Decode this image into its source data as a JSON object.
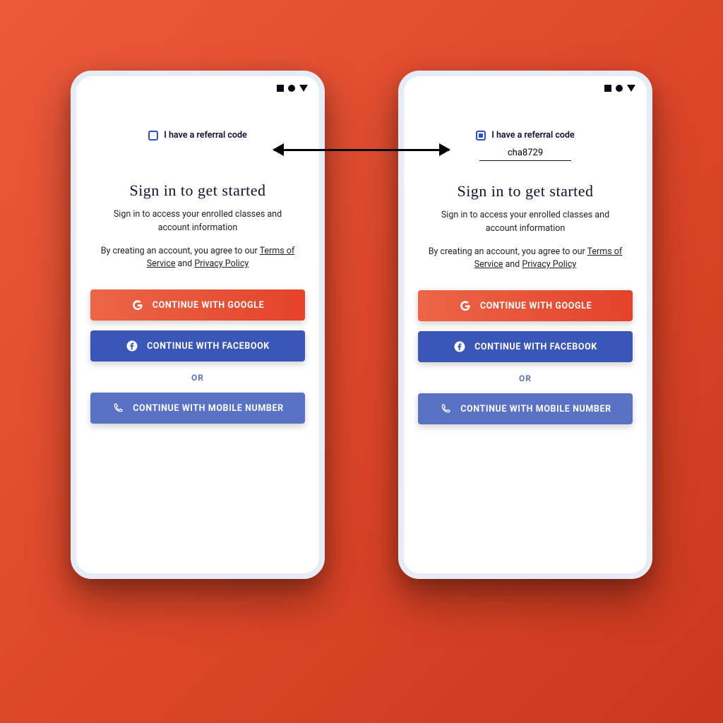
{
  "referral": {
    "label": "I have a referral code",
    "code_value": "cha8729"
  },
  "signin": {
    "title": "Sign in to get started",
    "subtitle": "Sign in to access your enrolled classes and account information",
    "terms_prefix": "By creating an account, you agree to our ",
    "terms_of_service": "Terms of Service",
    "and": " and ",
    "privacy_policy": "Privacy Policy"
  },
  "buttons": {
    "google": "CONTINUE WITH GOOGLE",
    "facebook": "CONTINUE WITH FACEBOOK",
    "or": "OR",
    "mobile": "CONTINUE WITH MOBILE NUMBER"
  },
  "icons": {
    "google": "google-icon",
    "facebook": "facebook-icon",
    "phone": "phone-icon"
  }
}
